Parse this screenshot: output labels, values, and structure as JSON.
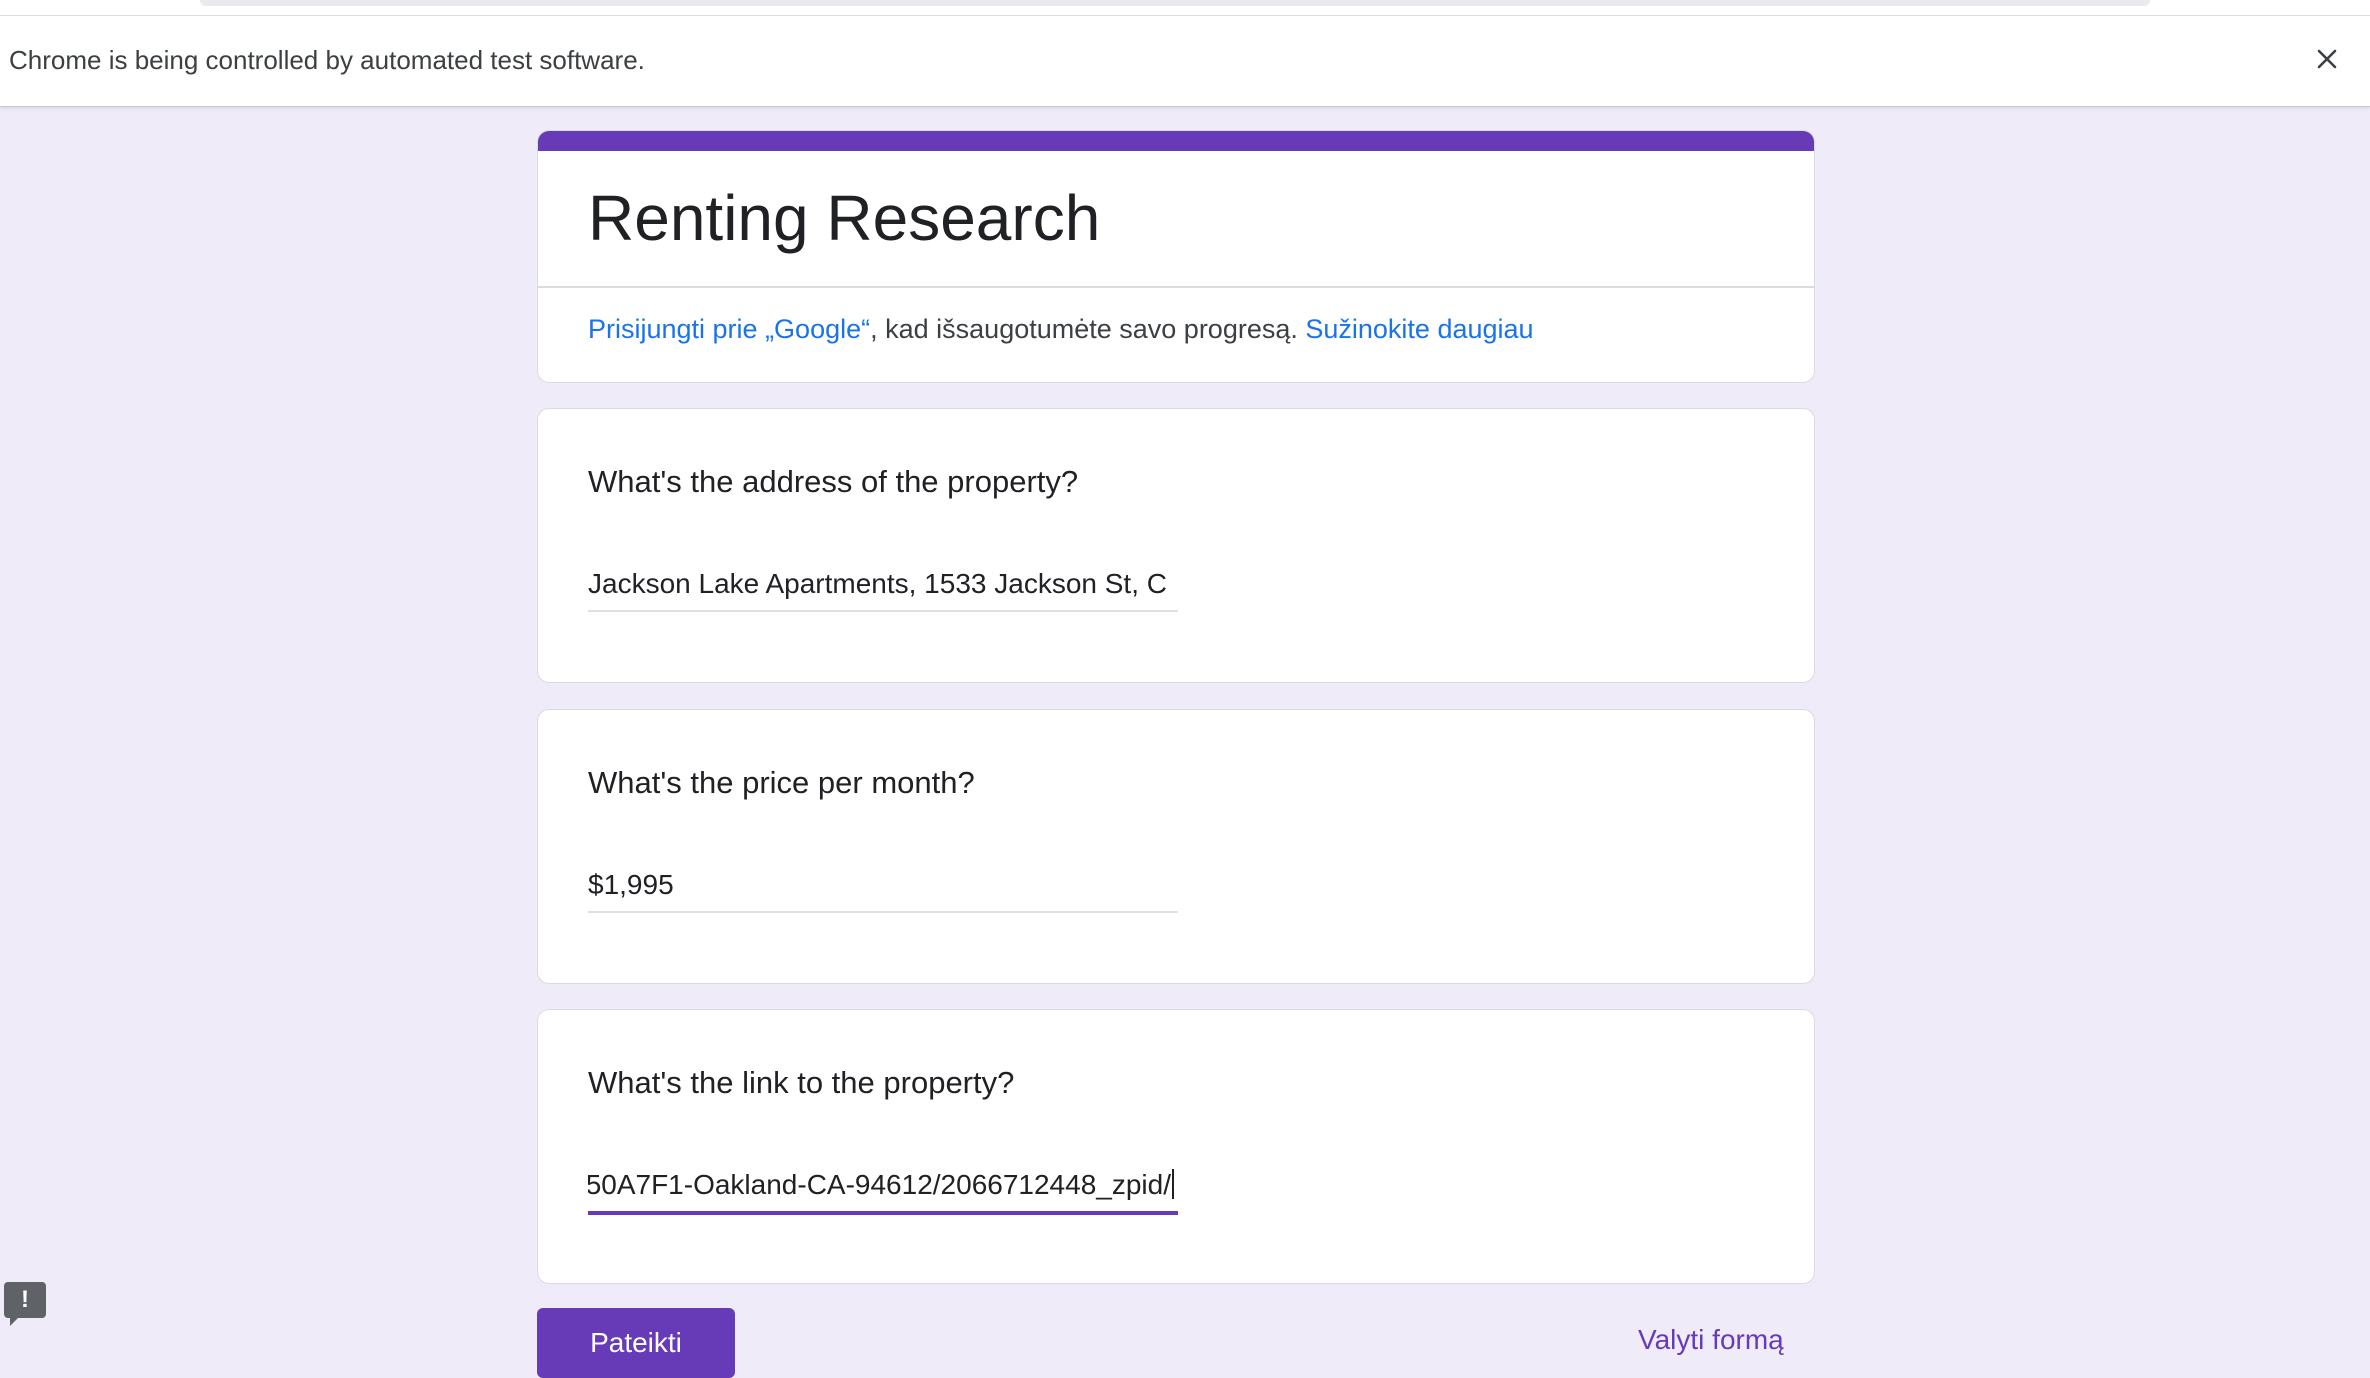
{
  "browser": {
    "infobar_message": "Chrome is being controlled by automated test software.",
    "close_icon": "close-icon"
  },
  "form": {
    "title": "Renting Research",
    "accent_color": "#673ab7",
    "signin_link": "Prisijungti prie „Google“",
    "signin_text": ", kad išsaugotumėte savo progresą. ",
    "learn_more": "Sužinokite daugiau",
    "questions": [
      {
        "label": "What's the address of the property?",
        "value": "Jackson Lake Apartments, 1533 Jackson St, C"
      },
      {
        "label": "What's the price per month?",
        "value": "$1,995"
      },
      {
        "label": "What's the link to the property?",
        "value": "50A7F1-Oakland-CA-94612/2066712448_zpid/"
      }
    ],
    "submit_label": "Pateikti",
    "clear_label": "Valyti formą"
  },
  "report_icon": "report-issue-icon"
}
